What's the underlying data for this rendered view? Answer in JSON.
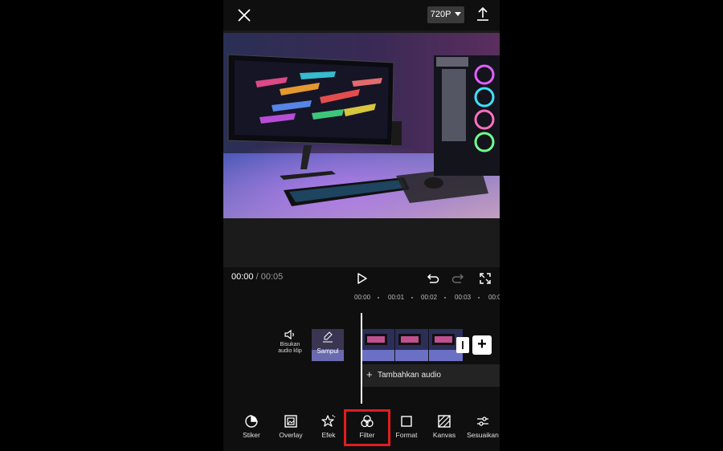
{
  "topbar": {
    "resolution_label": "720P"
  },
  "player": {
    "current_time": "00:00",
    "separator": "/",
    "duration": "00:05"
  },
  "ruler": {
    "ticks": [
      "00:00",
      "00:01",
      "00:02",
      "00:03",
      "00:0"
    ]
  },
  "timeline": {
    "mute_label_line1": "Bisukan",
    "mute_label_line2": "audio klip",
    "cover_label": "Sampul",
    "add_audio_label": "Tambahkan audio",
    "add_audio_plus": "+",
    "add_clip_plus": "+"
  },
  "toolbar": {
    "items": [
      {
        "label": "Stiker",
        "icon": "sticker-icon"
      },
      {
        "label": "Overlay",
        "icon": "overlay-icon"
      },
      {
        "label": "Efek",
        "icon": "effect-icon"
      },
      {
        "label": "Filter",
        "icon": "filter-icon"
      },
      {
        "label": "Format",
        "icon": "format-icon"
      },
      {
        "label": "Kanvas",
        "icon": "canvas-icon"
      },
      {
        "label": "Sesuaikan",
        "icon": "adjust-icon"
      }
    ],
    "highlight_color": "#e01e1e"
  },
  "colors": {
    "background": "#000000",
    "panel": "#0f0f0f",
    "preview_bg": "#1b1b1b",
    "audio_track": "#232323"
  }
}
